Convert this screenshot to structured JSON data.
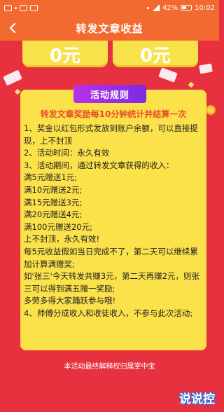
{
  "status_bar": {
    "battery_percent": "42%",
    "time": "10:02"
  },
  "nav": {
    "title": "转发文章收益"
  },
  "earnings": {
    "left_amount": "0元",
    "right_amount": "0元"
  },
  "rules": {
    "badge_label": "活动规则",
    "headline": "转发文章奖励每10分钟统计并结算一次",
    "lines": [
      "1、奖金以红包形式发放到账户余额，可以直接提",
      "现，上不封顶",
      "2、活动时间：永久有效",
      "3、活动期间，通过转发文章获得的收入：",
      "满5元赠送1元;",
      "满10元赠送2元;",
      "满15元赠送3元;",
      "满20元赠送4元;",
      "满100元赠送20元;",
      "上不封顶，永久有效!",
      "每5元收益假如当日完成不了，第二天可以继续累",
      "加计算满赠奖;",
      "如'张三'今天转发共赚3元，第二天再赚2元，则张",
      "三可以得到满五赠一奖励;",
      "多劳多得大家踊跃参与哦!",
      "4、师傅分成收入和收徒收入，不参与此次活动;"
    ]
  },
  "footer": {
    "note": "本活动最终解释权归属掌中宝"
  },
  "watermark": {
    "text": "说说控"
  }
}
